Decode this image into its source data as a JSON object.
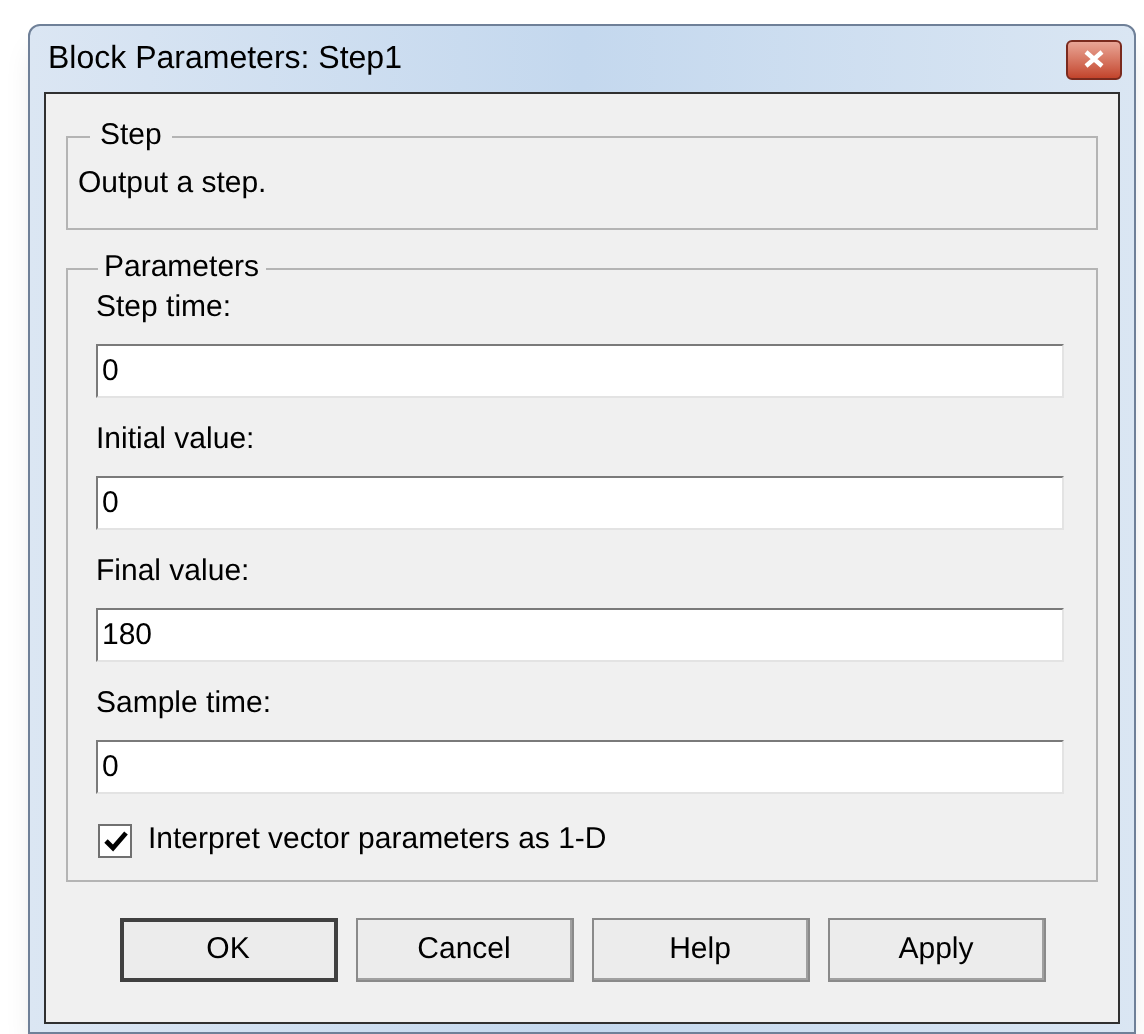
{
  "window": {
    "title": "Block Parameters: Step1"
  },
  "description_group": {
    "title": "Step",
    "text": "Output a step."
  },
  "parameters_group": {
    "title": "Parameters",
    "fields": [
      {
        "label": "Step time:",
        "value": "0"
      },
      {
        "label": "Initial value:",
        "value": "0"
      },
      {
        "label": "Final value:",
        "value": "180"
      },
      {
        "label": "Sample time:",
        "value": "0"
      }
    ],
    "checkbox": {
      "label": "Interpret vector parameters as 1-D",
      "checked": true
    }
  },
  "buttons": [
    {
      "label": "OK",
      "default": true
    },
    {
      "label": "Cancel",
      "default": false
    },
    {
      "label": "Help",
      "default": false
    },
    {
      "label": "Apply",
      "default": false
    }
  ]
}
